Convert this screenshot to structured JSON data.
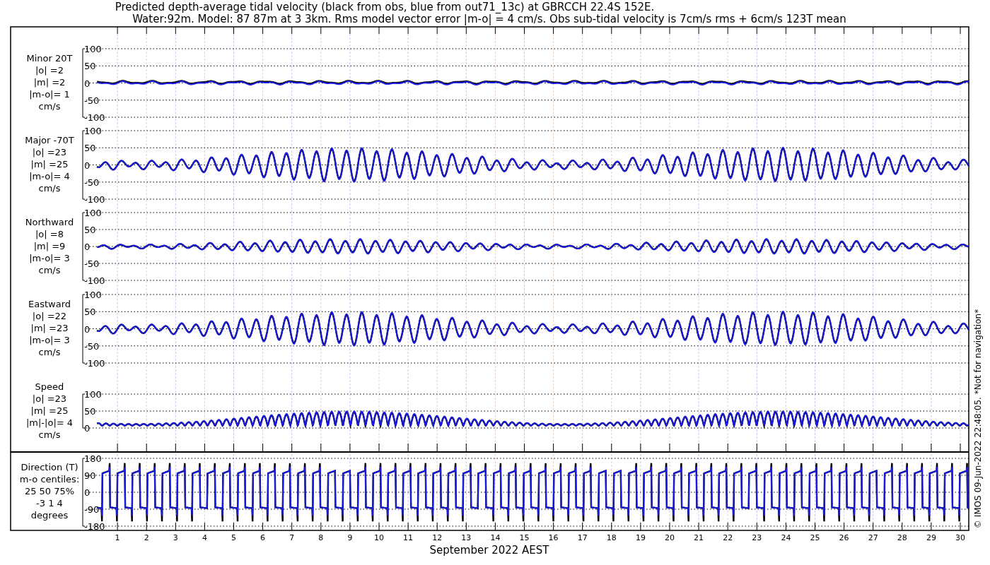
{
  "title": [
    "Predicted depth-average tidal velocity (black from obs, blue from out71_13c) at GBRCCH 22.4S 152E.",
    "Water:92m. Model: 87 87m at 3 3km. Rms model vector error |m-o| = 4 cm/s. Obs sub-tidal velocity is 7cm/s rms + 6cm/s 123T mean"
  ],
  "panels": [
    {
      "kind": "minor",
      "label": [
        "Minor 20T",
        "|o| =2",
        "|m| =2",
        "|m-o|= 1",
        "cm/s"
      ],
      "yticks": [
        "100",
        "50",
        "0",
        "-50",
        "-100"
      ]
    },
    {
      "kind": "vector",
      "label": [
        "Major -70T",
        "|o| =23",
        "|m| =25",
        "|m-o|= 4",
        "cm/s"
      ],
      "yticks": [
        "100",
        "50",
        "0",
        "-50",
        "-100"
      ]
    },
    {
      "kind": "north",
      "label": [
        "Northward",
        "|o| =8",
        "|m| =9",
        "|m-o|= 3",
        "cm/s"
      ],
      "yticks": [
        "100",
        "50",
        "0",
        "-50",
        "-100"
      ]
    },
    {
      "kind": "vector",
      "label": [
        "Eastward",
        "|o| =22",
        "|m| =23",
        "|m-o|= 3",
        "cm/s"
      ],
      "yticks": [
        "100",
        "50",
        "0",
        "-50",
        "-100"
      ]
    },
    {
      "kind": "speed",
      "label": [
        "Speed",
        "|o| =23",
        "|m| =25",
        "|m|-|o|= 4",
        "cm/s"
      ],
      "yticks": [
        "100",
        "50",
        "0"
      ]
    },
    {
      "kind": "direction",
      "label": [
        "Direction (T)",
        "m-o centiles:",
        "25  50  75%",
        "-3  1  4",
        "degrees"
      ],
      "yticks": [
        "180",
        "90",
        "0",
        "-90",
        "-180"
      ]
    }
  ],
  "xaxis": {
    "days": [
      "1",
      "2",
      "3",
      "4",
      "5",
      "6",
      "7",
      "8",
      "9",
      "10",
      "11",
      "12",
      "13",
      "14",
      "15",
      "16",
      "17",
      "18",
      "19",
      "20",
      "21",
      "22",
      "23",
      "24",
      "25",
      "26",
      "27",
      "28",
      "29",
      "30"
    ],
    "label": "September 2022 AEST"
  },
  "credit": "© IMOS 09-Jun-2022 22:48:05. *Not for navigation*"
}
